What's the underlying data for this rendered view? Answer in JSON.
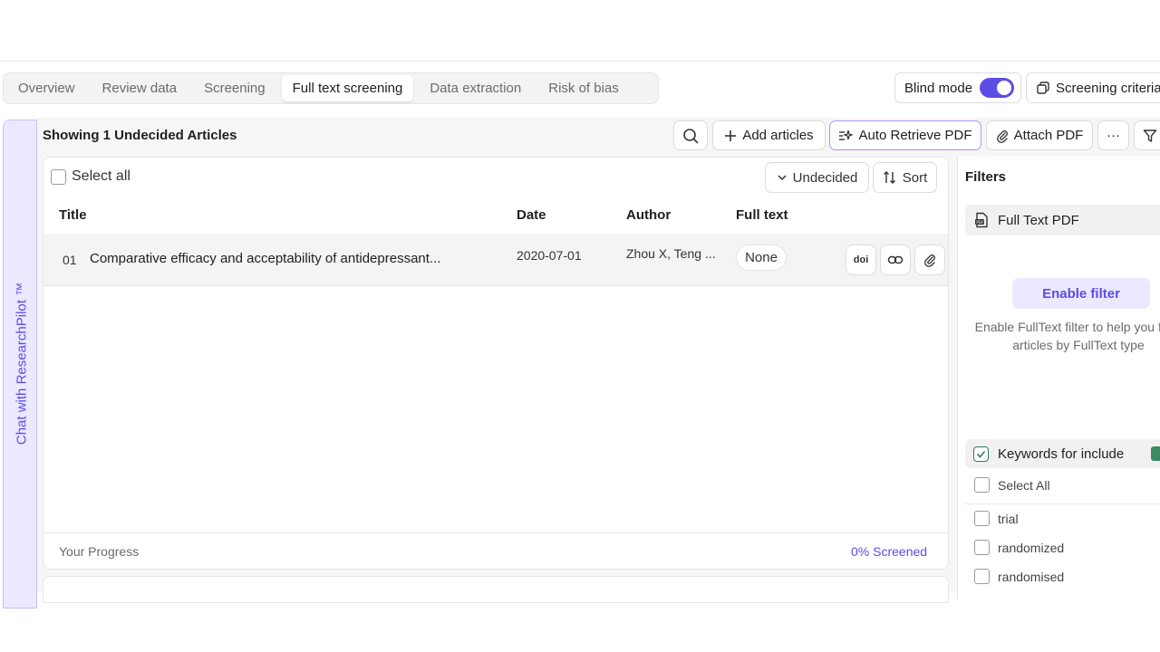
{
  "tabs": [
    "Overview",
    "Review data",
    "Screening",
    "Full text screening",
    "Data extraction",
    "Risk of bias"
  ],
  "active_tab": "Full text screening",
  "blind_mode": {
    "label": "Blind mode",
    "enabled": true
  },
  "screening_criteria_label": "Screening criteria",
  "chat_label": "Chat with ResearchPilot ™",
  "header": {
    "showing": "Showing 1 Undecided Articles"
  },
  "toolbar": {
    "add_articles": "Add articles",
    "auto_retrieve": "Auto Retrieve PDF",
    "attach_pdf": "Attach PDF",
    "more": "···"
  },
  "list": {
    "select_all": "Select all",
    "status_filter": "Undecided",
    "sort": "Sort",
    "columns": {
      "title": "Title",
      "date": "Date",
      "author": "Author",
      "full_text": "Full text"
    },
    "rows": [
      {
        "num": "01",
        "title": "Comparative efficacy and acceptability of antidepressant...",
        "date": "2020-07-01",
        "author": "Zhou X, Teng ...",
        "full_text": "None",
        "doi_label": "doi"
      }
    ]
  },
  "progress": {
    "label": "Your Progress",
    "value": "0% Screened"
  },
  "filters": {
    "title": "Filters",
    "full_text_pdf": "Full Text PDF",
    "enable_button": "Enable filter",
    "enable_desc": "Enable FullText filter to help you filter articles by FullText type",
    "keywords_label": "Keywords for include",
    "select_all": "Select All",
    "keywords": [
      "trial",
      "randomized",
      "randomised"
    ]
  },
  "colors": {
    "accent": "#5b4de6",
    "accent_light": "#ebe8ff",
    "green": "#3d8a64"
  }
}
